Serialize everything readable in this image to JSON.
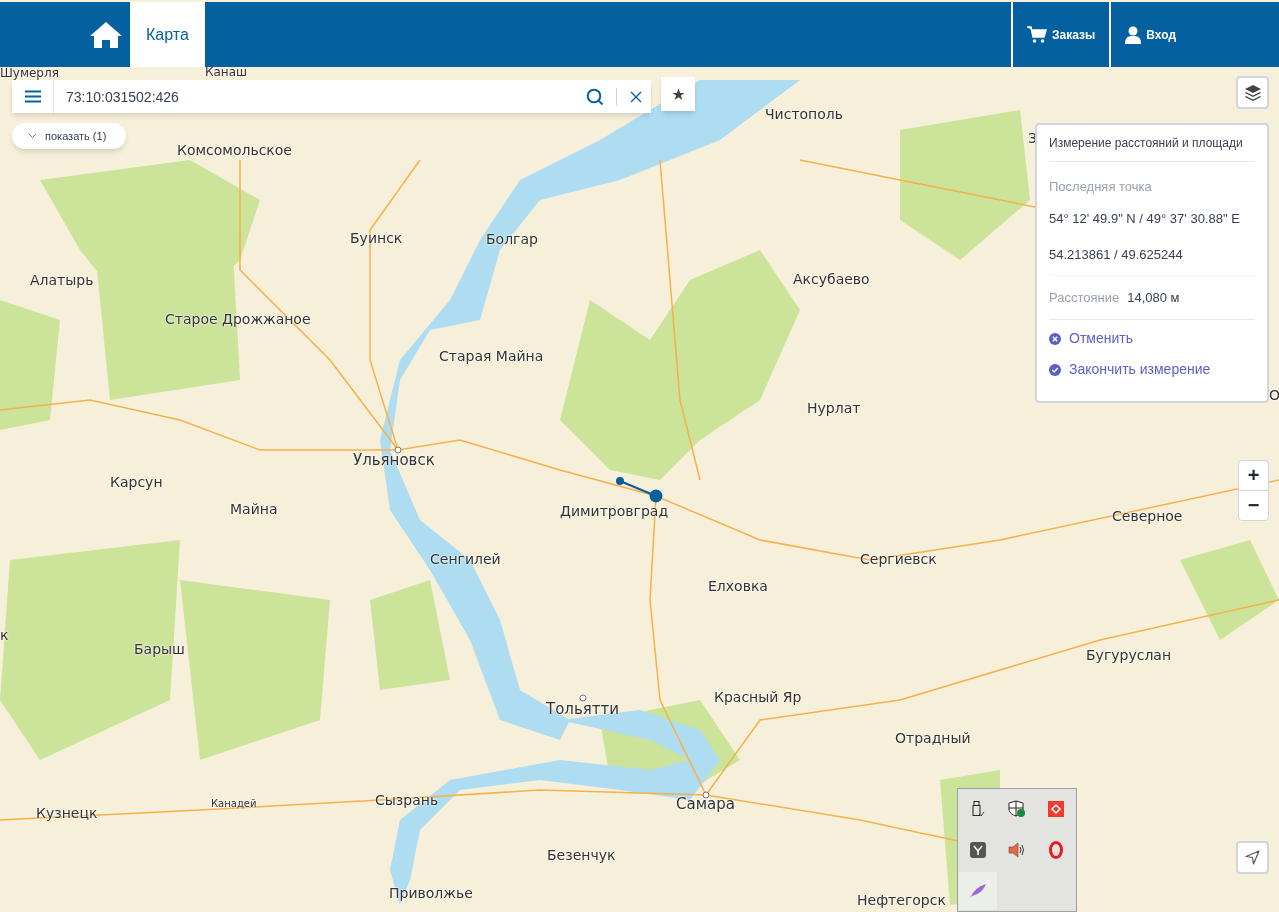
{
  "header": {
    "tabs": [
      {
        "label": "Карта",
        "selected": true
      }
    ],
    "buttons": [
      {
        "kind": "orders",
        "label": "Заказы"
      },
      {
        "kind": "login",
        "label": "Вход"
      }
    ]
  },
  "search": {
    "value": "73:10:031502:426"
  },
  "show_button": {
    "label": "показать (1)"
  },
  "measure_panel": {
    "title": "Измерение расстояний и площади",
    "last_point_label": "Последняя точка",
    "coords_dms": "54° 12' 49.9\" N / 49° 37' 30.88\" E",
    "coords_decimal": "54.213861 / 49.625244",
    "distance_label": "Расстояние",
    "distance_value": "14,080 м",
    "actions": [
      {
        "kind": "cancel",
        "label": "Отменить"
      },
      {
        "kind": "finish",
        "label": "Закончить измерение"
      }
    ]
  },
  "zoom": {
    "in": "+",
    "out": "−"
  },
  "map": {
    "labels": [
      {
        "text": "Шумерля",
        "kind": "town"
      },
      {
        "text": "Канаш",
        "kind": "town"
      },
      {
        "text": "Чистополь",
        "kind": "town"
      },
      {
        "text": "Комсомольское",
        "kind": "town"
      },
      {
        "text": "Буинск",
        "kind": "town"
      },
      {
        "text": "Болгар",
        "kind": "town"
      },
      {
        "text": "Алатырь",
        "kind": "town"
      },
      {
        "text": "Аксубаево",
        "kind": "town"
      },
      {
        "text": "Старое Дрожжаное",
        "kind": "town"
      },
      {
        "text": "Старая Майна",
        "kind": "town"
      },
      {
        "text": "Нурлат",
        "kind": "town"
      },
      {
        "text": "Ульяновск",
        "kind": "city"
      },
      {
        "text": "Карсун",
        "kind": "town"
      },
      {
        "text": "Майна",
        "kind": "town"
      },
      {
        "text": "Димитровград",
        "kind": "town"
      },
      {
        "text": "Северное",
        "kind": "town"
      },
      {
        "text": "Сенгилей",
        "kind": "town"
      },
      {
        "text": "Сергиевск",
        "kind": "town"
      },
      {
        "text": "Елховка",
        "kind": "town"
      },
      {
        "text": "Барыш",
        "kind": "town"
      },
      {
        "text": "Бугуруслан",
        "kind": "town"
      },
      {
        "text": "Тольятти",
        "kind": "city"
      },
      {
        "text": "Красный Яр",
        "kind": "town"
      },
      {
        "text": "Отрадный",
        "kind": "town"
      },
      {
        "text": "Канадей",
        "kind": "village"
      },
      {
        "text": "Сызрань",
        "kind": "town"
      },
      {
        "text": "Самара",
        "kind": "city"
      },
      {
        "text": "Кузнецк",
        "kind": "town"
      },
      {
        "text": "Безенчук",
        "kind": "town"
      },
      {
        "text": "Приволжье",
        "kind": "town"
      },
      {
        "text": "Нефтегорск",
        "kind": "town"
      },
      {
        "text": "З",
        "kind": "town"
      },
      {
        "text": "О",
        "kind": "town"
      },
      {
        "text": "к",
        "kind": "town"
      }
    ]
  }
}
